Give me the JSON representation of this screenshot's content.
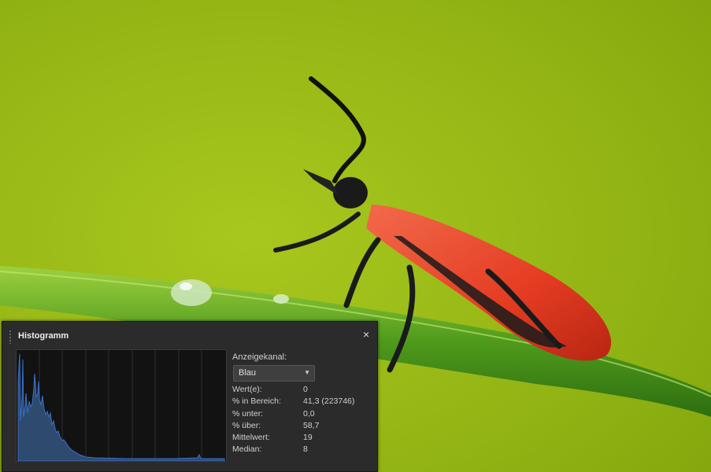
{
  "panel": {
    "title": "Histogramm",
    "close_label": "×",
    "channel_label": "Anzeigekanal:",
    "channel_value": "Blau",
    "histogram_color": "#3a6fc8",
    "stats": [
      {
        "key": "Wert(e):",
        "value": "0"
      },
      {
        "key": "% in Bereich:",
        "value": "41,3 (223746)"
      },
      {
        "key": "% unter:",
        "value": "0,0"
      },
      {
        "key": "% über:",
        "value": "58,7"
      },
      {
        "key": "Mittelwert:",
        "value": "19"
      },
      {
        "key": "Median:",
        "value": "8"
      }
    ]
  },
  "photo": {
    "background_color": "#8fb212",
    "beetle_color": "#e8432a"
  }
}
